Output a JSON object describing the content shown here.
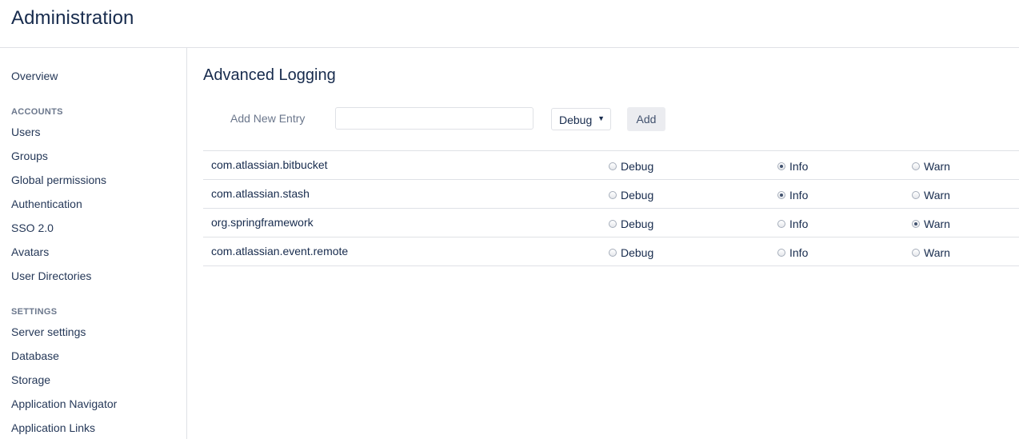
{
  "header": {
    "title": "Administration"
  },
  "sidebar": {
    "overview": "Overview",
    "accounts_heading": "ACCOUNTS",
    "accounts": [
      "Users",
      "Groups",
      "Global permissions",
      "Authentication",
      "SSO 2.0",
      "Avatars",
      "User Directories"
    ],
    "settings_heading": "SETTINGS",
    "settings": [
      "Server settings",
      "Database",
      "Storage",
      "Application Navigator",
      "Application Links"
    ]
  },
  "main": {
    "title": "Advanced Logging",
    "add_entry": {
      "label": "Add New Entry",
      "input_value": "",
      "selected_level": "Debug",
      "add_button": "Add"
    },
    "level_options": [
      "Debug",
      "Info",
      "Warn"
    ],
    "loggers": [
      {
        "name": "com.atlassian.bitbucket",
        "level": "Info"
      },
      {
        "name": "com.atlassian.stash",
        "level": "Info"
      },
      {
        "name": "org.springframework",
        "level": "Warn"
      },
      {
        "name": "com.atlassian.event.remote",
        "level": ""
      }
    ]
  }
}
